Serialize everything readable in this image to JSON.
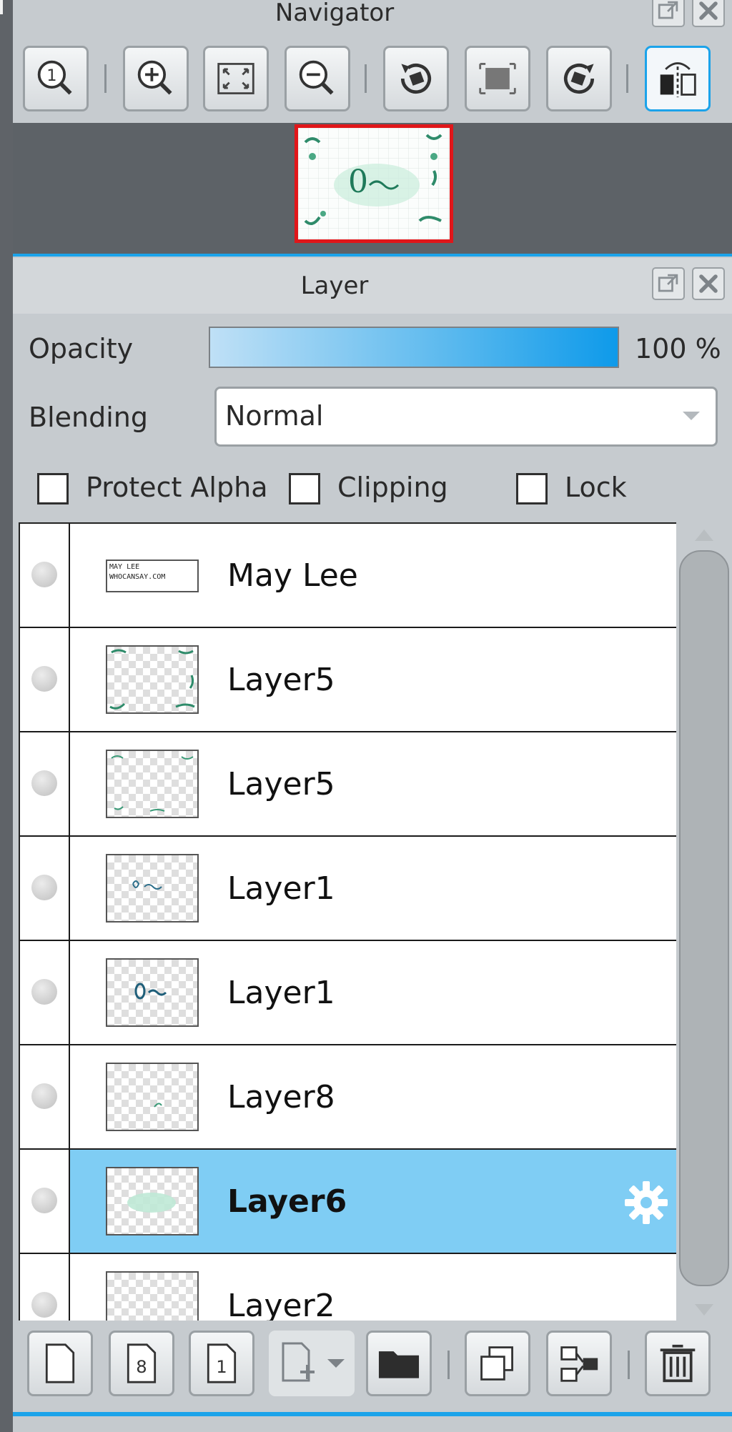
{
  "navigator": {
    "title": "Navigator",
    "tools": [
      {
        "icon": "zoom-actual-icon"
      },
      {
        "icon": "zoom-in-icon"
      },
      {
        "icon": "fit-screen-icon"
      },
      {
        "icon": "zoom-out-icon"
      },
      {
        "icon": "rotate-left-icon"
      },
      {
        "icon": "reset-view-icon"
      },
      {
        "icon": "rotate-right-icon"
      },
      {
        "icon": "flip-horizontal-icon",
        "active": true
      }
    ]
  },
  "layer_panel": {
    "title": "Layer",
    "opacity_label": "Opacity",
    "opacity_value": "100 %",
    "opacity_fraction": 1.0,
    "blending_label": "Blending",
    "blending_value": "Normal",
    "checkboxes": {
      "protect_alpha": "Protect Alpha",
      "clipping": "Clipping",
      "lock": "Lock"
    },
    "layers": [
      {
        "name": "May Lee",
        "thumb_text_1": "MAY LEE",
        "thumb_text_2": "WHOCANSAY.COM"
      },
      {
        "name": "Layer5"
      },
      {
        "name": "Layer5"
      },
      {
        "name": "Layer1"
      },
      {
        "name": "Layer1"
      },
      {
        "name": "Layer8"
      },
      {
        "name": "Layer6",
        "selected": true
      },
      {
        "name": "Layer2"
      }
    ],
    "bottom_tools": [
      {
        "icon": "new-layer-icon"
      },
      {
        "icon": "new-8bit-layer-icon",
        "label": "8"
      },
      {
        "icon": "new-1bit-layer-icon",
        "label": "1"
      },
      {
        "icon": "add-layer-dropdown-icon"
      },
      {
        "icon": "new-folder-icon"
      },
      {
        "icon": "duplicate-layer-icon"
      },
      {
        "icon": "merge-down-icon"
      },
      {
        "icon": "delete-layer-icon"
      }
    ]
  },
  "colors": {
    "accent": "#1ba3ea",
    "selected_row": "#7fcdf4",
    "preview_border": "#e0161a"
  }
}
